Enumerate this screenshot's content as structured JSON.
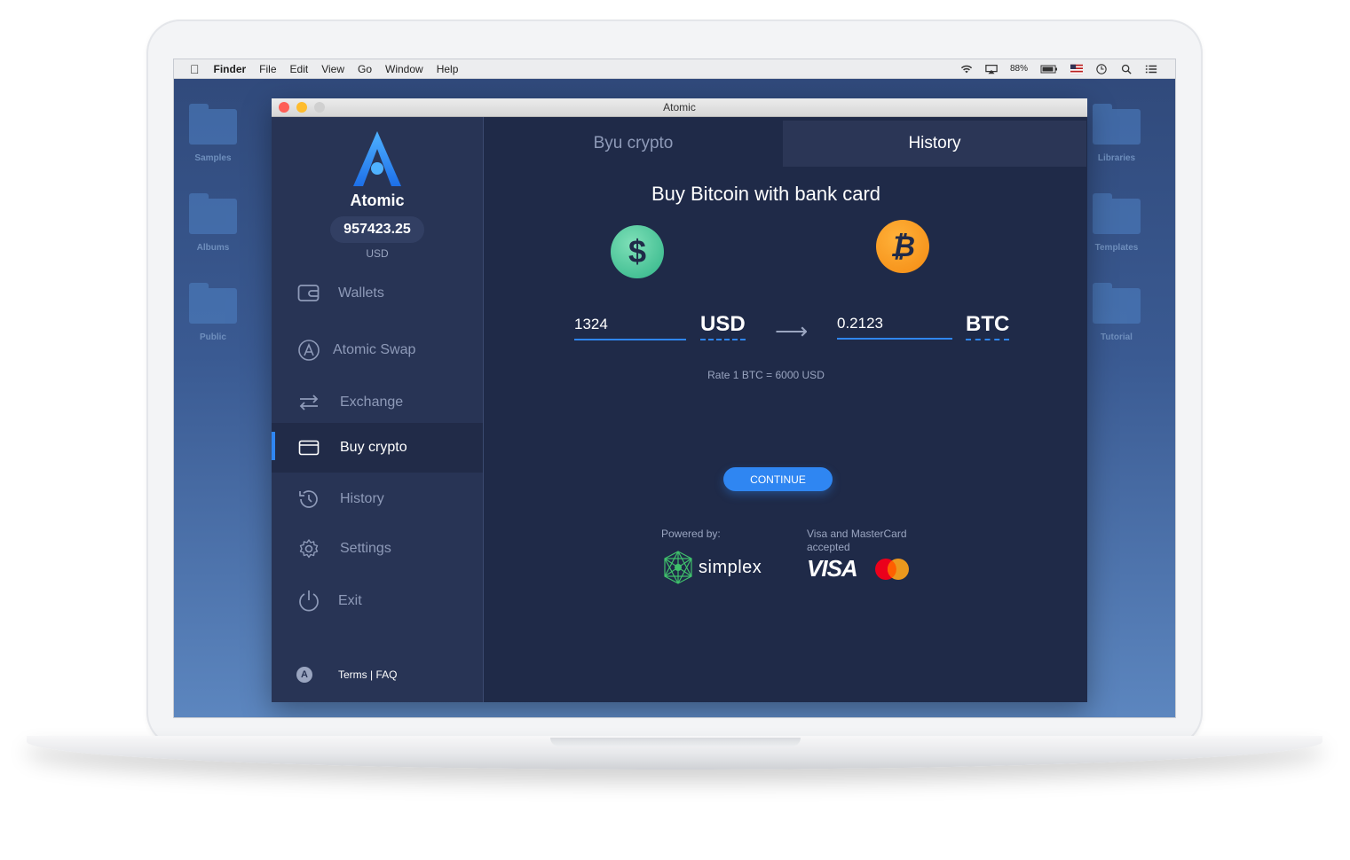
{
  "menubar": {
    "app": "Finder",
    "items": [
      "File",
      "Edit",
      "View",
      "Go",
      "Window",
      "Help"
    ],
    "battery": "88%"
  },
  "desktop": {
    "left_folders": [
      "Samples",
      "Albums",
      "Public"
    ],
    "right_folders": [
      "Libraries",
      "Templates",
      "Tutorial"
    ]
  },
  "window": {
    "title": "Atomic"
  },
  "sidebar": {
    "brand": "Atomic",
    "balance": "957423.25",
    "currency": "USD",
    "items": [
      {
        "label": "Wallets",
        "icon": "wallet-icon"
      },
      {
        "label": "Atomic Swap",
        "icon": "atomic-swap-icon"
      },
      {
        "label": "Exchange",
        "icon": "exchange-icon"
      },
      {
        "label": "Buy crypto",
        "icon": "card-icon",
        "active": true
      },
      {
        "label": "History",
        "icon": "history-icon"
      },
      {
        "label": "Settings",
        "icon": "gear-icon"
      },
      {
        "label": "Exit",
        "icon": "power-icon"
      }
    ],
    "footer": "Terms | FAQ"
  },
  "tabs": {
    "buy": "Byu crypto",
    "history": "History"
  },
  "main": {
    "heading": "Buy Bitcoin with bank card",
    "from_amount": "1324",
    "from_currency": "USD",
    "to_amount": "0.2123",
    "to_currency": "BTC",
    "rate": "Rate  1 BTC = 6000 USD",
    "continue": "CONTINUE",
    "powered_by": "Powered by:",
    "simplex": "simplex",
    "cards_accepted": "Visa and MasterCard accepted",
    "visa": "VISA"
  },
  "colors": {
    "accent": "#2f86f2",
    "sidebar_bg": "#283455",
    "main_bg": "#1f2a48",
    "usd_coin": "#2fb487",
    "btc_coin": "#f48a12"
  }
}
